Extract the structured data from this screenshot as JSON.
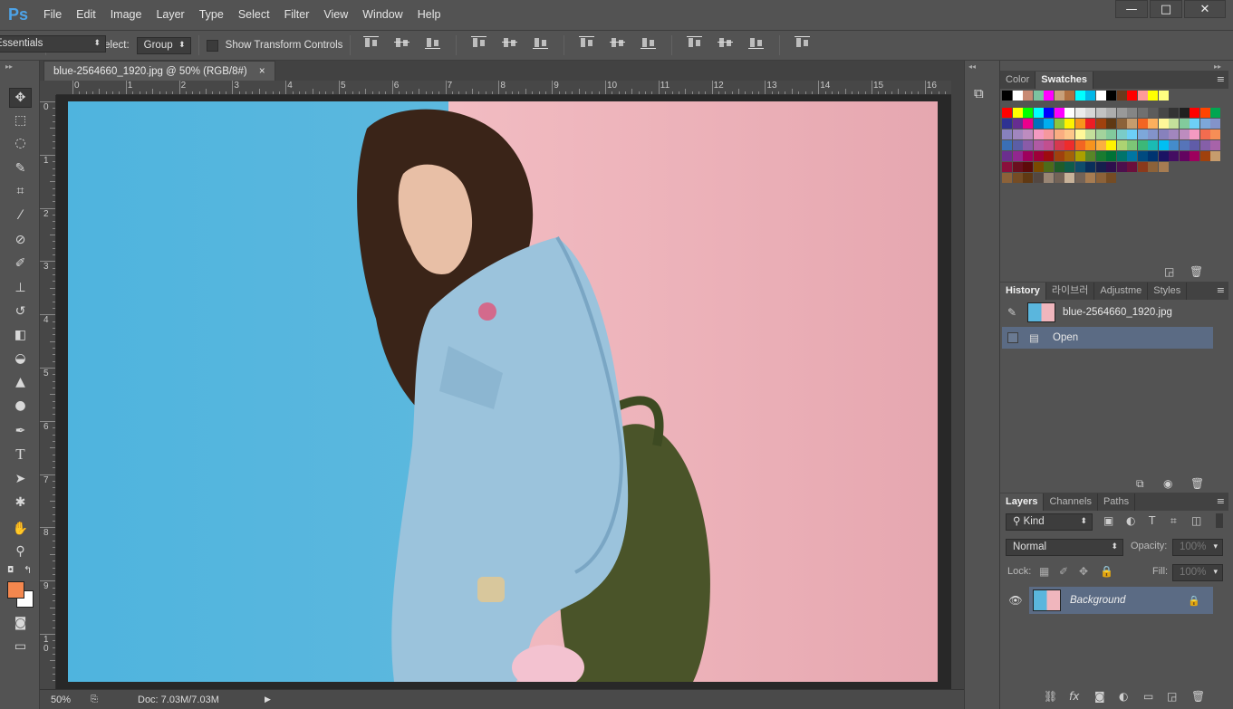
{
  "app": {
    "logo": "Ps"
  },
  "menu": [
    "File",
    "Edit",
    "Image",
    "Layer",
    "Type",
    "Select",
    "Filter",
    "View",
    "Window",
    "Help"
  ],
  "window_controls": {
    "minimize": "—",
    "maximize": "□",
    "close": "✕"
  },
  "options": {
    "auto_select_label": "Auto-Select:",
    "auto_select_value": "Group",
    "transform_label": "Show Transform Controls",
    "workspace": "Essentials"
  },
  "document": {
    "tab_title": "blue-2564660_1920.jpg @ 50% (RGB/8#)",
    "close_glyph": "×",
    "ruler_h": [
      "0",
      "1",
      "2",
      "3",
      "4",
      "5",
      "6",
      "7",
      "8",
      "9",
      "10",
      "11",
      "12",
      "13",
      "14",
      "15",
      "16"
    ],
    "ruler_v": [
      "0",
      "1",
      "2",
      "3",
      "4",
      "5",
      "6",
      "7",
      "8",
      "9",
      "1\n0"
    ]
  },
  "status": {
    "zoom": "50%",
    "doc_info": "Doc: 7.03M/7.03M"
  },
  "color_panel": {
    "tabs": [
      "Color",
      "Swatches"
    ],
    "active_tab": "Swatches",
    "swatch_rows": [
      [
        "#000000",
        "#ffffff",
        "#c88a73",
        "#7cc2a0",
        "#ff00ff",
        "#c8a07a",
        "#b07040",
        "#00ffff",
        "#00b7e8",
        "#ffffff",
        "#000000",
        "#6a3a1c",
        "#ff0000",
        "#ff9a9a",
        "#ffff00",
        "#ffff80"
      ],
      [],
      [
        "#ff0000",
        "#ffff00",
        "#00ff00",
        "#00ffff",
        "#0000ff",
        "#ff00ff",
        "#ffffff",
        "#ebebeb",
        "#d6d6d6",
        "#c2c2c2",
        "#adadad",
        "#999999",
        "#858585",
        "#707070",
        "#5c5c5c",
        "#474747",
        "#333333",
        "#1f1f1f",
        "#ff0000",
        "#ff4400",
        "#00a651"
      ],
      [
        "#2e3192",
        "#662d91",
        "#ec008c",
        "#0072bc",
        "#00aeef",
        "#8dc63f",
        "#fff200",
        "#f7941d",
        "#ed1c24",
        "#a0410d",
        "#603913",
        "#8c6239",
        "#c69c6d",
        "#f26522",
        "#fbaf5d",
        "#fff799",
        "#c4df9b",
        "#82ca9c",
        "#6dcff6",
        "#7da7d9",
        "#8393ca"
      ],
      [
        "#8781bd",
        "#a186be",
        "#bd8cbf",
        "#f49ac1",
        "#f5989d",
        "#f9ad81",
        "#fdc689",
        "#fff799",
        "#c4df9b",
        "#a3d39c",
        "#82ca9c",
        "#7accc8",
        "#6dcff6",
        "#7da7d9",
        "#8393ca",
        "#8781bd",
        "#a186be",
        "#bd8cbf",
        "#f49ac1",
        "#f26c4f",
        "#f68e56"
      ],
      [
        "#3a6fb5",
        "#5b5ea6",
        "#8a5ba8",
        "#b05aa4",
        "#c14f8f",
        "#d6384f",
        "#ee2c2c",
        "#f26522",
        "#f7941d",
        "#fbaf3f",
        "#fff200",
        "#acd372",
        "#7cc576",
        "#3cb878",
        "#1abbb4",
        "#00bff3",
        "#448ccb",
        "#5674b9",
        "#605ca8",
        "#855fa8",
        "#a763a9"
      ],
      [
        "#6b2f8e",
        "#92278f",
        "#9e005d",
        "#9e0039",
        "#9e0b0f",
        "#a0410d",
        "#a36209",
        "#aba000",
        "#598527",
        "#197b30",
        "#007236",
        "#00746b",
        "#0076a3",
        "#004a80",
        "#003471",
        "#1b1464",
        "#440e62",
        "#630460",
        "#9e005d",
        "#a0410d",
        "#c69c6d"
      ],
      [
        "#8a0f3c",
        "#6a0f1f",
        "#5d0a0a",
        "#7a4a00",
        "#4d6b1a",
        "#1f5c2a",
        "#0f5c4a",
        "#0f4c6b",
        "#0a2f5a",
        "#161f4d",
        "#2e0f4d",
        "#4d0f4d",
        "#6b0f3c",
        "#8a3a1c",
        "#8c6239",
        "#a67c52"
      ],
      [
        "#8c6239",
        "#754c24",
        "#603913",
        "#534741",
        "#998675",
        "#736357",
        "#c7b299",
        "#736357",
        "#a67c52",
        "#8c6239",
        "#754c24"
      ]
    ]
  },
  "history_panel": {
    "tabs": [
      "History",
      "라이브러",
      "Adjustme",
      "Styles"
    ],
    "active_tab": "History",
    "snapshot": "blue-2564660_1920.jpg",
    "states": [
      "Open"
    ]
  },
  "layers_panel": {
    "tabs": [
      "Layers",
      "Channels",
      "Paths"
    ],
    "active_tab": "Layers",
    "filter_kind": "Kind",
    "blend_mode": "Normal",
    "opacity_label": "Opacity:",
    "opacity_value": "100%",
    "lock_label": "Lock:",
    "fill_label": "Fill:",
    "fill_value": "100%",
    "layers": [
      {
        "name": "Background"
      }
    ]
  },
  "colors": {
    "foreground": "#f4874e",
    "background": "#ffffff",
    "accent_select": "#5b6b84"
  }
}
